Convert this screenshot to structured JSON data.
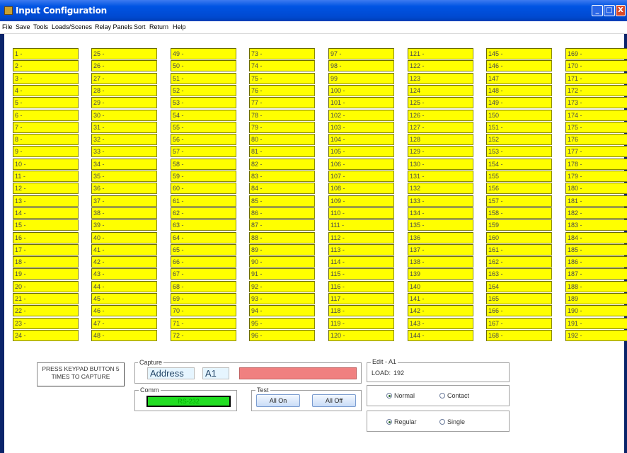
{
  "window": {
    "title": "Input Configuration",
    "min_glyph": "_",
    "max_glyph": "□",
    "close_glyph": "X"
  },
  "menu": [
    "File",
    "Save",
    "Tools",
    "Loads/Scenes",
    "Relay Panels",
    "Sort",
    "Return",
    "Help"
  ],
  "grid_columns": [
    [
      "1 -",
      "2 -",
      "3 -",
      "4 -",
      "5 -",
      "6 -",
      "7 -",
      "8 -",
      "9 -",
      "10 -",
      "11 -",
      "12 -",
      "13 -",
      "14 -",
      "15 -",
      "16 -",
      "17 -",
      "18 -",
      "19 -",
      "20 -",
      "21 -",
      "22 -",
      "23 -",
      "24 -"
    ],
    [
      "25 -",
      "26 -",
      "27 -",
      "28 -",
      "29 -",
      "30 -",
      "31 -",
      "32 -",
      "33 -",
      "34 -",
      "35 -",
      "36 -",
      "37 -",
      "38 -",
      "39 -",
      "40 -",
      "41 -",
      "42 -",
      "43 -",
      "44 -",
      "45 -",
      "46 -",
      "47 -",
      "48 -"
    ],
    [
      "49 -",
      "50 -",
      "51 -",
      "52 -",
      "53 -",
      "54 -",
      "55 -",
      "56 -",
      "57 -",
      "58 -",
      "59 -",
      "60 -",
      "61 -",
      "62 -",
      "63 -",
      "64 -",
      "65 -",
      "66 -",
      "67 -",
      "68 -",
      "69 -",
      "70 -",
      "71 -",
      "72 -"
    ],
    [
      "73 -",
      "74 -",
      "75 -",
      "76 -",
      "77 -",
      "78 -",
      "79 -",
      "80 -",
      "81 -",
      "82 -",
      "83 -",
      "84 -",
      "85 -",
      "86 -",
      "87 -",
      "88 -",
      "89 -",
      "90 -",
      "91 -",
      "92 -",
      "93 -",
      "94 -",
      "95 -",
      "96 -"
    ],
    [
      "97 -",
      "98 -",
      "99",
      "100 -",
      "101 -",
      "102 -",
      "103 -",
      "104 -",
      "105 -",
      "106 -",
      "107 -",
      "108 -",
      "109 -",
      "110 -",
      "111 -",
      "112 -",
      "113 -",
      "114 -",
      "115 -",
      "116 -",
      "117 -",
      "118 -",
      "119 -",
      "120 -"
    ],
    [
      "121 -",
      "122 -",
      "123",
      "124",
      "125 -",
      "126 -",
      "127 -",
      "128",
      "129 -",
      "130 -",
      "131 -",
      "132",
      "133 -",
      "134 -",
      "135 -",
      "136",
      "137 -",
      "138 -",
      "139",
      "140",
      "141 -",
      "142 -",
      "143 -",
      "144 -"
    ],
    [
      "145 -",
      "146 -",
      "147",
      "148 -",
      "149 -",
      "150",
      "151 -",
      "152",
      "153 -",
      "154 -",
      "155",
      "156",
      "157 -",
      "158 -",
      "159",
      "160",
      "161 -",
      "162 -",
      "163 -",
      "164",
      "165",
      "166 -",
      "167 -",
      "168 -"
    ],
    [
      "169 -",
      "170 -",
      "171 -",
      "172 -",
      "173 -",
      "174 -",
      "175 -",
      "176",
      "177 -",
      "178 -",
      "179 -",
      "180 -",
      "181 -",
      "182 -",
      "183 -",
      "184 -",
      "185 -",
      "186 -",
      "187 -",
      "188 -",
      "189",
      "190 -",
      "191 -",
      "192 -"
    ]
  ],
  "press_box": {
    "line1": "PRESS KEYPAD BUTTON 5",
    "line2": "TIMES TO CAPTURE"
  },
  "capture": {
    "legend": "Capture",
    "address_label": "Address",
    "address_value": "A1"
  },
  "comm": {
    "legend": "Comm",
    "status": "RS-232"
  },
  "test": {
    "legend": "Test",
    "all_on": "All On",
    "all_off": "All Off"
  },
  "edit": {
    "legend": "Edit - A1",
    "load_label": "LOAD:",
    "load_value": "192"
  },
  "mode_group": {
    "option1": "Normal",
    "option1_selected": true,
    "option2": "Contact",
    "option2_selected": false
  },
  "type_group": {
    "option1": "Regular",
    "option1_selected": true,
    "option2": "Single",
    "option2_selected": false
  },
  "colors": {
    "cell_bg": "#ffff00",
    "capture_bar": "#f08080",
    "comm_bar": "#22dd22",
    "title_blue": "#0054e3"
  }
}
